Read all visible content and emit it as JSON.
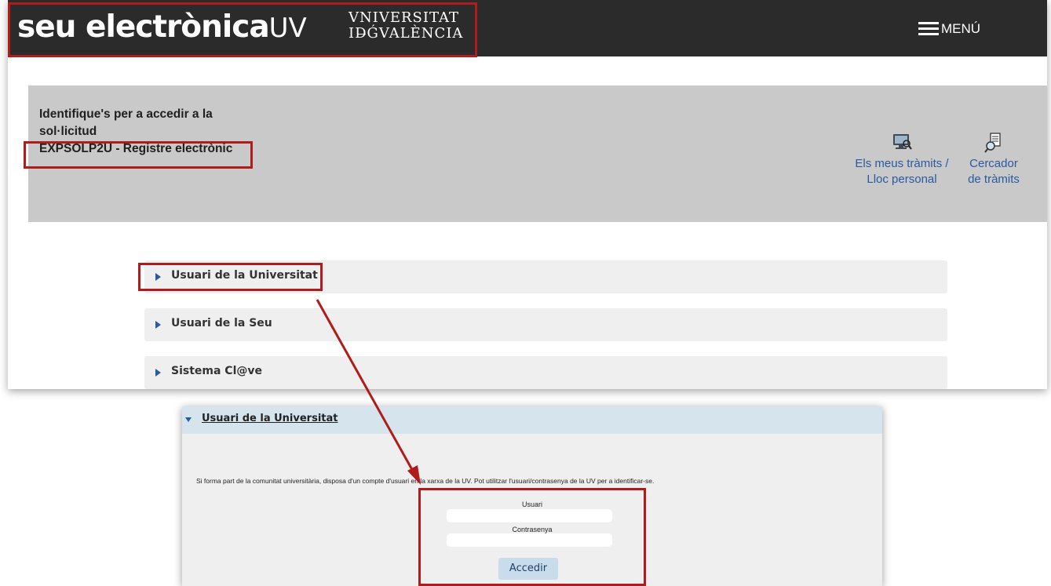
{
  "header": {
    "logo_main": "seu electrònica",
    "logo_suffix": "UV",
    "university_line1": "VNIVERSITAT",
    "university_line2": "ID̶ǴVALÈNCIA",
    "menu_label": "MENÚ"
  },
  "banner": {
    "line1": "Identifique's per a accedir a la",
    "line2": "sol·licitud",
    "procedure": "EXPSOLP2U - Registre electrònic"
  },
  "shortcuts": [
    {
      "line1": "Els meus tràmits /",
      "line2": "Lloc personal",
      "icon": "monitor-search-icon"
    },
    {
      "line1": "Cercador",
      "line2": "de tràmits",
      "icon": "document-search-icon"
    }
  ],
  "login_options": [
    {
      "label": "Usuari de la Universitat"
    },
    {
      "label": "Usuari de la Seu"
    },
    {
      "label": "Sistema Cl@ve"
    }
  ],
  "expanded_panel": {
    "title": "Usuari de la Universitat",
    "description": "Si forma part de la comunitat universitària, disposa d'un compte d'usuari en la xarxa de la UV. Pot utilitzar l'usuari/contrasenya de la UV per a identificar-se.",
    "user_label": "Usuari",
    "user_value": "",
    "password_label": "Contrasenya",
    "password_value": "",
    "submit_label": "Accedir"
  },
  "colors": {
    "header_bg": "#2b2b2b",
    "highlight_red": "#b01c1c",
    "link_blue": "#2a5aa0",
    "banner_grey": "#c9c9c9"
  }
}
